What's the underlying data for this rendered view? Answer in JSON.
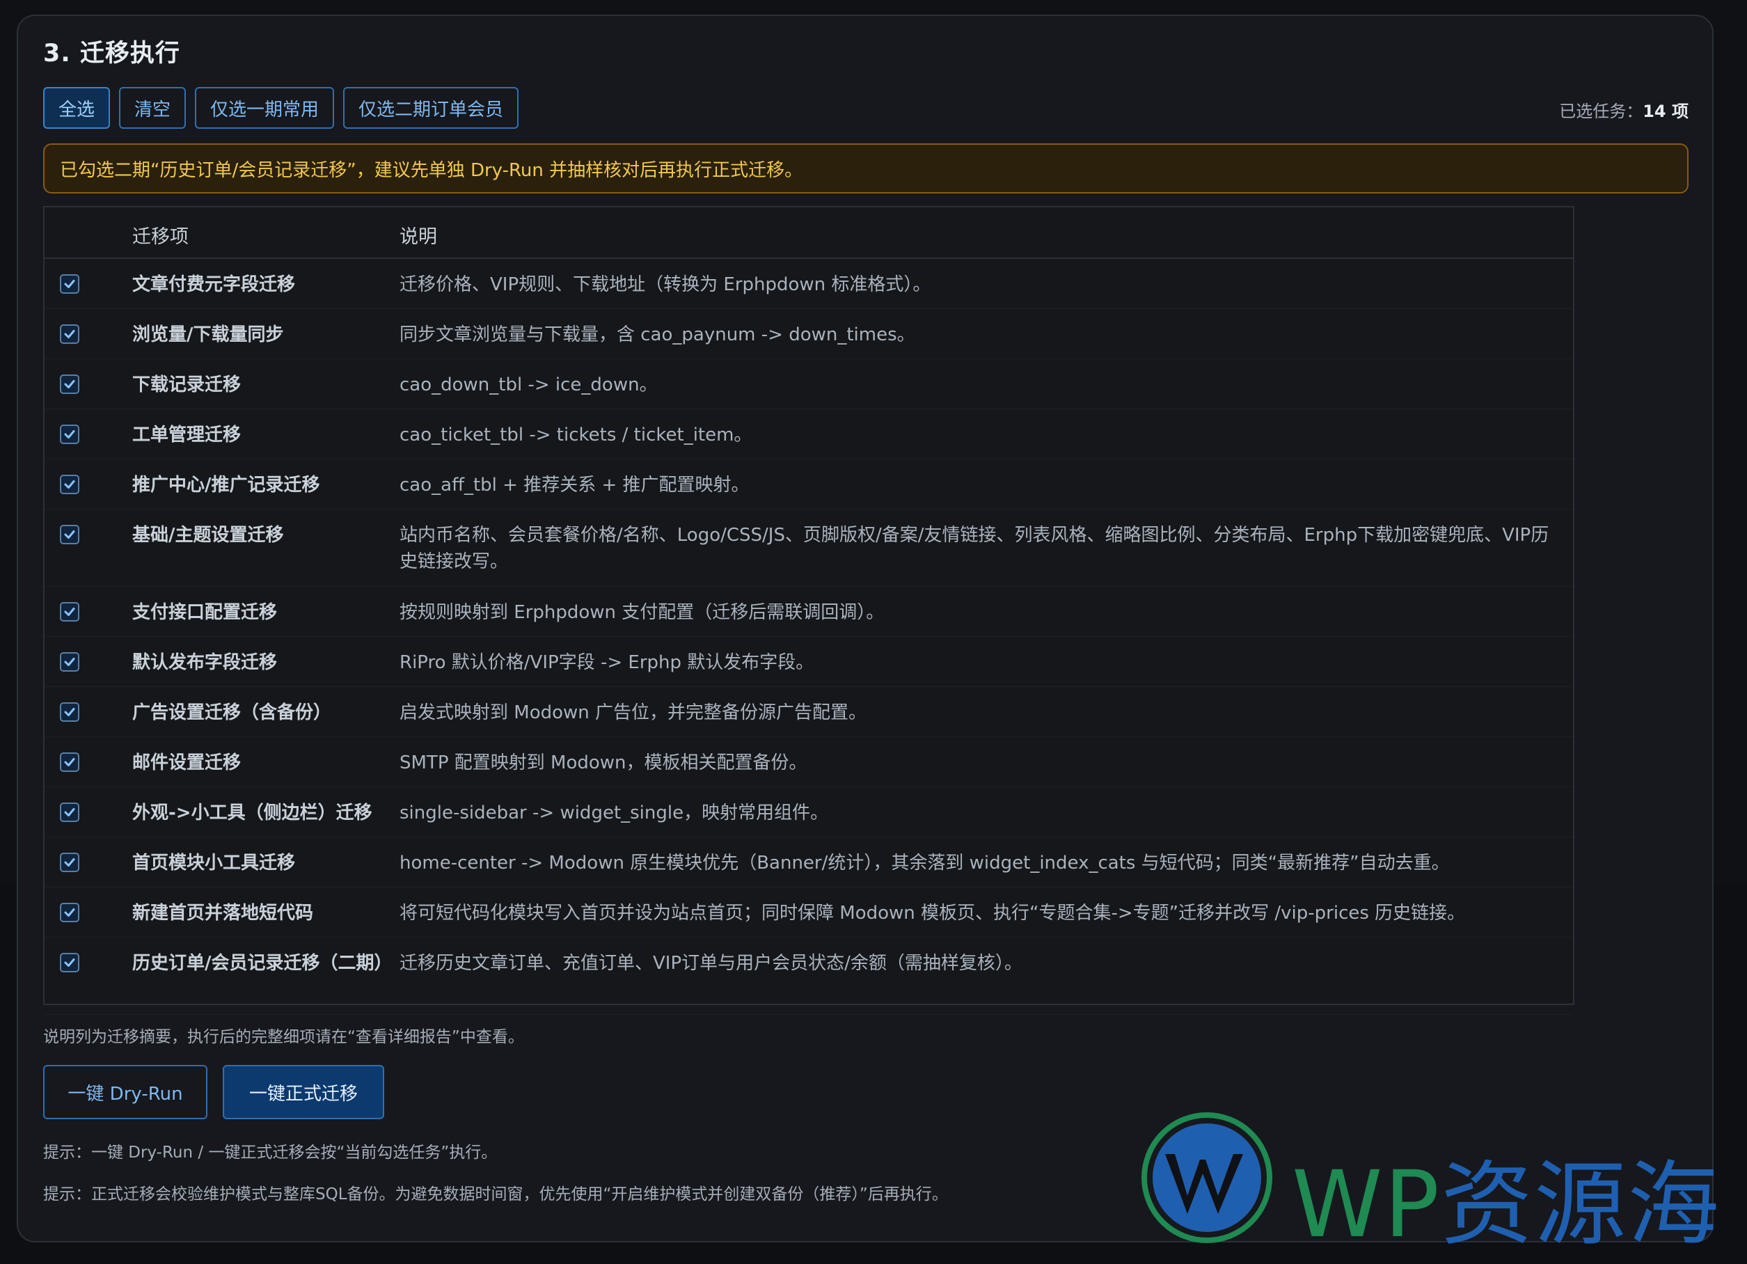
{
  "section": {
    "title": "3. 迁移执行"
  },
  "toolbar": {
    "buttons": [
      {
        "label": "全选"
      },
      {
        "label": "清空"
      },
      {
        "label": "仅选一期常用"
      },
      {
        "label": "仅选二期订单会员"
      }
    ],
    "selected_prefix": "已选任务：",
    "selected_count": "14",
    "selected_suffix": " 项"
  },
  "warning": {
    "text": "已勾选二期“历史订单/会员记录迁移”，建议先单独 Dry-Run 并抽样核对后再执行正式迁移。"
  },
  "table": {
    "headers": {
      "item": "迁移项",
      "desc": "说明"
    },
    "rows": [
      {
        "name": "文章付费元字段迁移",
        "desc": "迁移价格、VIP规则、下载地址（转换为 Erphpdown 标准格式）。"
      },
      {
        "name": "浏览量/下载量同步",
        "desc": "同步文章浏览量与下载量，含 cao_paynum -> down_times。"
      },
      {
        "name": "下载记录迁移",
        "desc": "cao_down_tbl -> ice_down。"
      },
      {
        "name": "工单管理迁移",
        "desc": "cao_ticket_tbl -> tickets / ticket_item。"
      },
      {
        "name": "推广中心/推广记录迁移",
        "desc": "cao_aff_tbl + 推荐关系 + 推广配置映射。"
      },
      {
        "name": "基础/主题设置迁移",
        "desc": "站内币名称、会员套餐价格/名称、Logo/CSS/JS、页脚版权/备案/友情链接、列表风格、缩略图比例、分类布局、Erphp下载加密键兜底、VIP历史链接改写。"
      },
      {
        "name": "支付接口配置迁移",
        "desc": "按规则映射到 Erphpdown 支付配置（迁移后需联调回调）。"
      },
      {
        "name": "默认发布字段迁移",
        "desc": "RiPro 默认价格/VIP字段 -> Erphp 默认发布字段。"
      },
      {
        "name": "广告设置迁移（含备份）",
        "desc": "启发式映射到 Modown 广告位，并完整备份源广告配置。"
      },
      {
        "name": "邮件设置迁移",
        "desc": "SMTP 配置映射到 Modown，模板相关配置备份。"
      },
      {
        "name": "外观->小工具（侧边栏）迁移",
        "desc": "single-sidebar -> widget_single，映射常用组件。"
      },
      {
        "name": "首页模块小工具迁移",
        "desc": "home-center -> Modown 原生模块优先（Banner/统计），其余落到 widget_index_cats 与短代码；同类“最新推荐”自动去重。"
      },
      {
        "name": "新建首页并落地短代码",
        "desc": "将可短代码化模块写入首页并设为站点首页；同时保障 Modown 模板页、执行“专题合集->专题”迁移并改写 /vip-prices 历史链接。"
      },
      {
        "name": "历史订单/会员记录迁移（二期）",
        "desc": "迁移历史文章订单、充值订单、VIP订单与用户会员状态/余额（需抽样复核）。"
      }
    ]
  },
  "note": {
    "text": "说明列为迁移摘要，执行后的完整细项请在“查看详细报告”中查看。"
  },
  "actions": {
    "dry_run_label": "一键 Dry-Run",
    "migrate_label": "一键正式迁移"
  },
  "hints": {
    "hint1": "提示：一键 Dry-Run / 一键正式迁移会按“当前勾选任务”执行。",
    "hint2": "提示：正式迁移会校验维护模式与整库SQL备份。为避免数据时间窗，优先使用“开启维护模式并创建双备份（推荐）”后再执行。"
  },
  "watermark": {
    "latin": "WP",
    "cjk": "资源海"
  },
  "colors": {
    "accent": "#2f6fb1",
    "warning_text": "#f2c94c",
    "warning_border": "#8a5a10",
    "watermark_green": "#1f8a52",
    "watermark_blue": "#1f5fb0"
  }
}
